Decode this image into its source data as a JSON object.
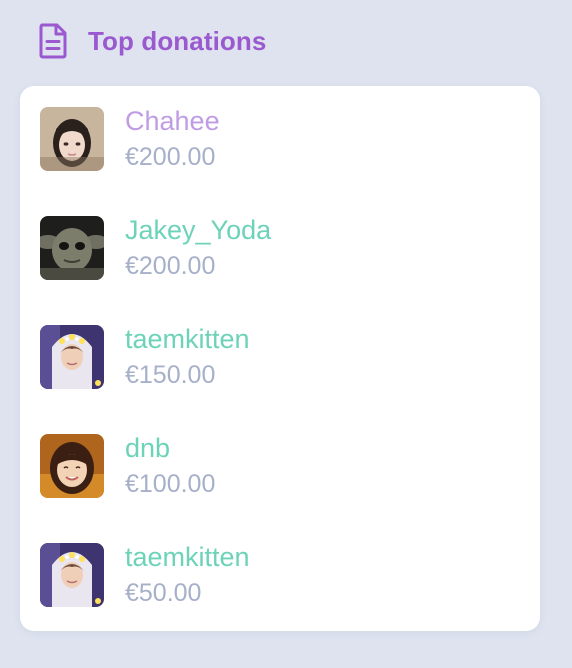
{
  "header": {
    "title": "Top donations",
    "icon": "document-icon",
    "accent_color": "#9b59d0"
  },
  "colors": {
    "top_donor_name": "#c09ce4",
    "donor_name": "#6dd3b8",
    "amount": "#a7b0c9",
    "background": "#dee3ef",
    "card": "#ffffff"
  },
  "donations": [
    {
      "name": "Chahee",
      "amount": "€200.00",
      "avatar": "avatar-photo"
    },
    {
      "name": "Jakey_Yoda",
      "amount": "€200.00",
      "avatar": "avatar-photo"
    },
    {
      "name": "taemkitten",
      "amount": "€150.00",
      "avatar": "avatar-photo"
    },
    {
      "name": "dnb",
      "amount": "€100.00",
      "avatar": "avatar-photo"
    },
    {
      "name": "taemkitten",
      "amount": "€50.00",
      "avatar": "avatar-photo"
    }
  ]
}
